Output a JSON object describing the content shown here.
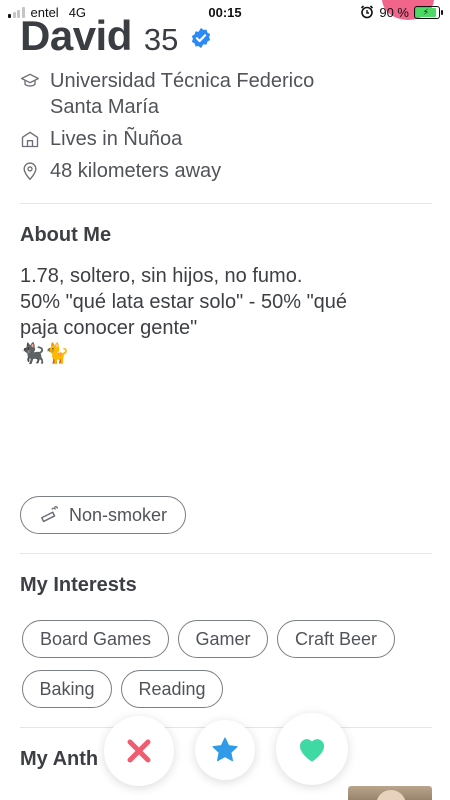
{
  "status_bar": {
    "carrier": "entel",
    "network": "4G",
    "time": "00:15",
    "battery": "90 %"
  },
  "profile": {
    "name": "David",
    "age": "35",
    "school_line1": "Universidad Técnica Federico",
    "school_line2": "Santa María",
    "location": "Lives in Ñuñoa",
    "distance": "48 kilometers away"
  },
  "about": {
    "title": "About Me",
    "line1": "1.78, soltero, sin hijos, no fumo.",
    "line2": "50% \"qué lata estar solo\" - 50% \"qué",
    "line3": "paja conocer gente\"",
    "line4": "🐈‍⬛🐈"
  },
  "lifestyle": {
    "smoking": "Non-smoker"
  },
  "interests": {
    "title": "My Interests",
    "items": [
      "Board Games",
      "Gamer",
      "Craft Beer",
      "Baking",
      "Reading"
    ]
  },
  "anthem": {
    "title": "My Anth"
  },
  "colors": {
    "nope": "#ef5b6f",
    "super_like": "#2f9be9",
    "like": "#3fd9a3",
    "verified": "#2b8af6"
  }
}
